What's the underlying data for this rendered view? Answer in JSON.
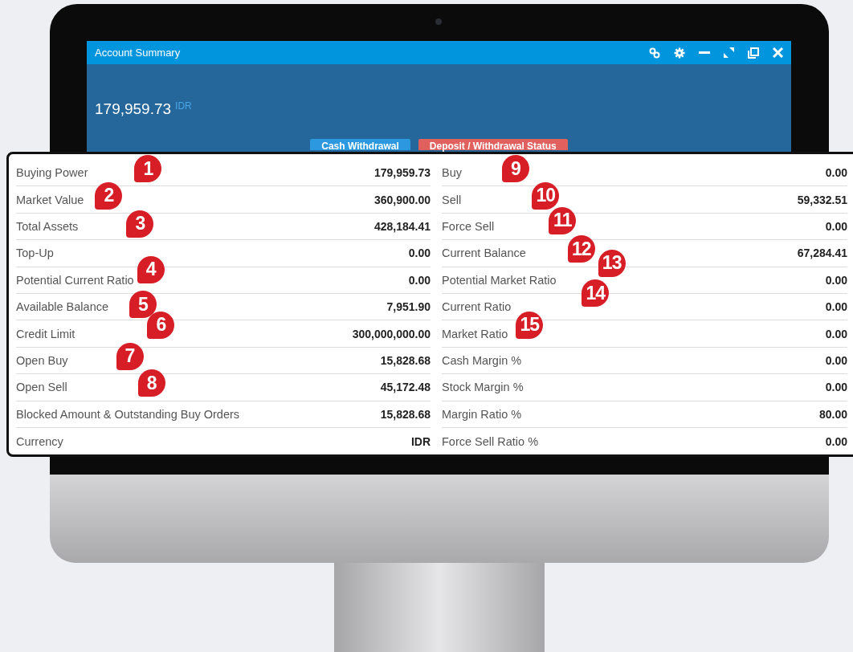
{
  "window": {
    "title": "Account Summary",
    "balance": "179,959.73",
    "currency": "IDR",
    "buttons": [
      {
        "label": "Cash Withdrawal",
        "kind": "primary"
      },
      {
        "label": "Deposit / Withdrawal Status",
        "kind": "danger"
      }
    ]
  },
  "summary": {
    "left": [
      {
        "label": "Buying Power",
        "value": "179,959.73",
        "callout": "1"
      },
      {
        "label": "Market Value",
        "value": "360,900.00",
        "callout": "2"
      },
      {
        "label": "Total Assets",
        "value": "428,184.41",
        "callout": "3"
      },
      {
        "label": "Top-Up",
        "value": "0.00"
      },
      {
        "label": "Potential Current Ratio",
        "value": "0.00",
        "callout": "4"
      },
      {
        "label": "Available Balance",
        "value": "7,951.90",
        "callout": "5"
      },
      {
        "label": "Credit Limit",
        "value": "300,000,000.00",
        "callout": "6"
      },
      {
        "label": "Open Buy",
        "value": "15,828.68",
        "callout": "7"
      },
      {
        "label": "Open Sell",
        "value": "45,172.48",
        "callout": "8"
      },
      {
        "label": "Blocked Amount & Outstanding Buy Orders",
        "value": "15,828.68"
      },
      {
        "label": "Currency",
        "value": "IDR"
      }
    ],
    "right": [
      {
        "label": "Buy",
        "value": "0.00",
        "callout": "9"
      },
      {
        "label": "Sell",
        "value": "59,332.51",
        "callout": "10"
      },
      {
        "label": "Force Sell",
        "value": "0.00",
        "callout": "11"
      },
      {
        "label": "Current Balance",
        "value": "67,284.41",
        "callout": "12"
      },
      {
        "label": "Potential Market Ratio",
        "value": "0.00",
        "callout": "13"
      },
      {
        "label": "Current Ratio",
        "value": "0.00",
        "callout": "14"
      },
      {
        "label": "Market Ratio",
        "value": "0.00",
        "callout": "15"
      },
      {
        "label": "Cash Margin %",
        "value": "0.00"
      },
      {
        "label": "Stock Margin %",
        "value": "0.00"
      },
      {
        "label": "Margin Ratio %",
        "value": "80.00"
      },
      {
        "label": "Force Sell Ratio %",
        "value": "0.00"
      }
    ]
  }
}
